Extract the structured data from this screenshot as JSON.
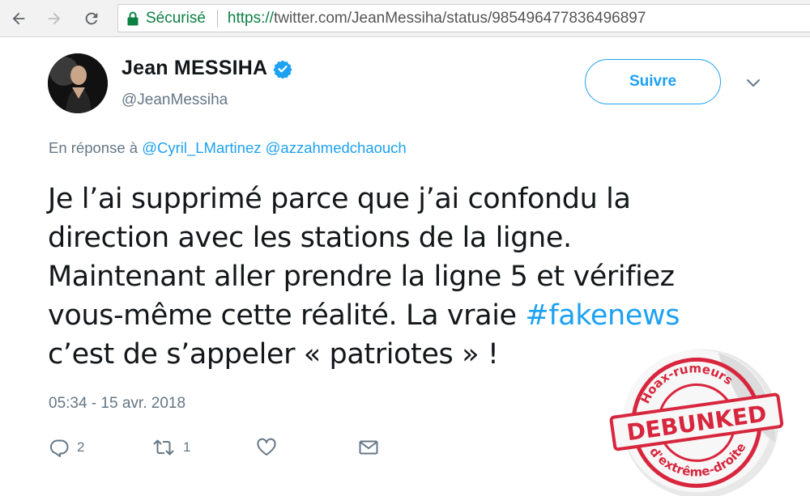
{
  "browser": {
    "secure_label": "Sécurisé",
    "url_scheme": "https://",
    "url_rest": "twitter.com/JeanMessiha/status/985496477836496897"
  },
  "tweet": {
    "author_name": "Jean MESSIHA",
    "author_handle": "@JeanMessiha",
    "follow_label": "Suivre",
    "reply_prefix": "En réponse à",
    "reply_mentions": [
      "@Cyril_LMartinez",
      "@azzahmedchaouch"
    ],
    "text_lines": [
      "Je l’ai supprimé parce que j’ai confondu la",
      "direction avec les stations de la ligne.",
      "Maintenant aller prendre la ligne 5 et vérifiez",
      "vous-même cette réalité. La vraie ",
      "c’est de s’appeler « patriotes » !"
    ],
    "hashtag": "#fakenews",
    "timestamp": "05:34 - 15 avr. 2018",
    "reply_count": "2",
    "retweet_count": "1",
    "accent_color": "#1da1f2"
  },
  "stamp": {
    "top_text": "Hoax-rumeurs",
    "center_text": "DEBUNKED",
    "bottom_text": "d'extrême-droite",
    "color": "#d7263d"
  }
}
